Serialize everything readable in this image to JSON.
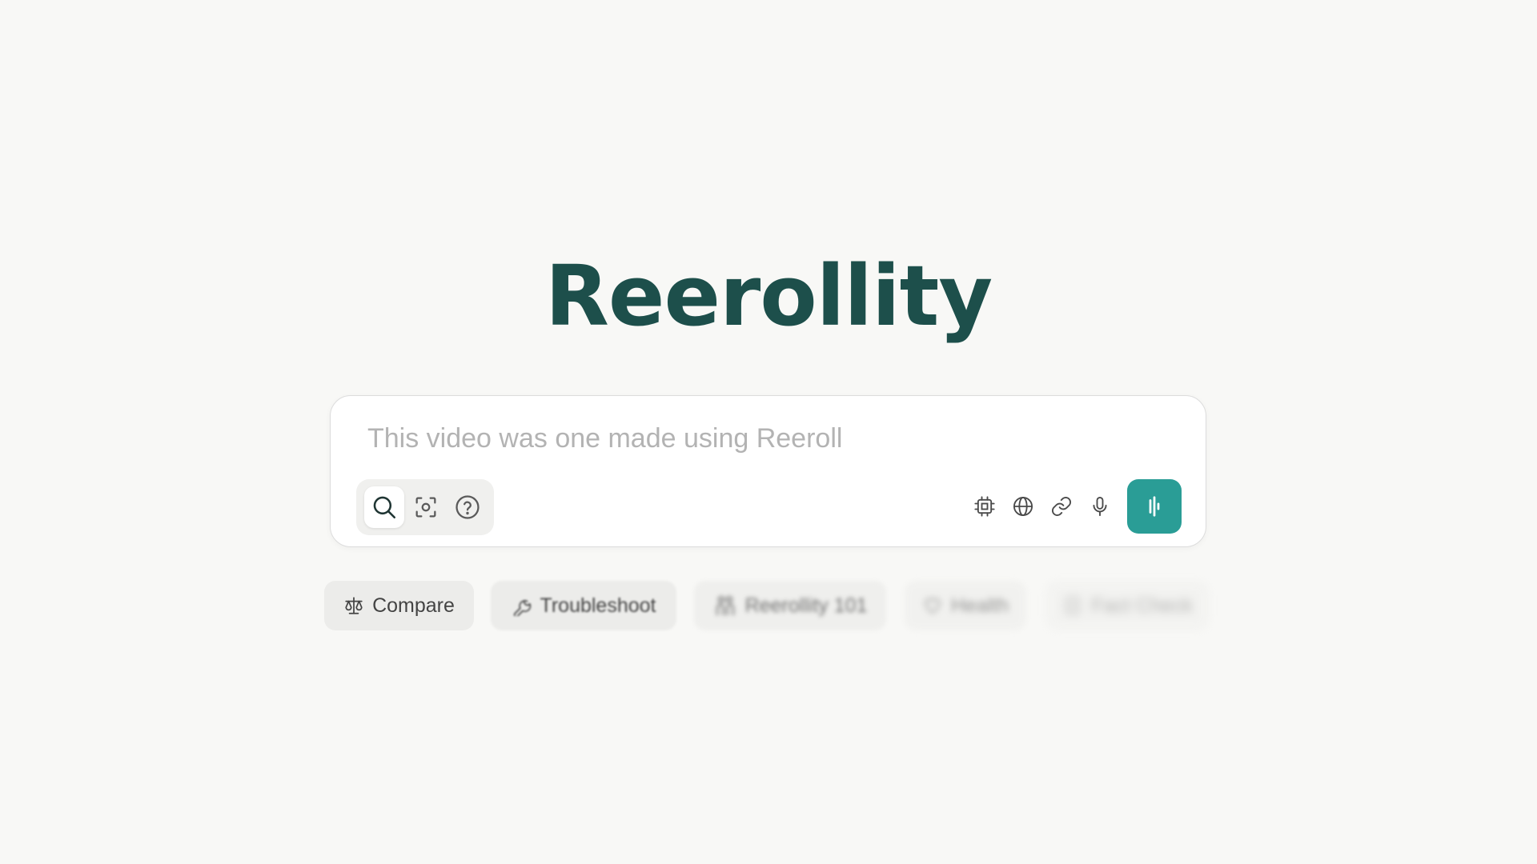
{
  "brand": {
    "logo_text": "Reerollity",
    "accent_color": "#2a9d96",
    "logo_color": "#1d4f4b"
  },
  "search": {
    "placeholder": "This video was one made using Reeroll",
    "value": ""
  },
  "modes": [
    {
      "icon": "search-icon",
      "active": true
    },
    {
      "icon": "focus-scan-icon",
      "active": false
    },
    {
      "icon": "help-circle-icon",
      "active": false
    }
  ],
  "tools": [
    {
      "icon": "chip-icon"
    },
    {
      "icon": "globe-icon"
    },
    {
      "icon": "link-icon"
    },
    {
      "icon": "microphone-icon"
    }
  ],
  "voice_button": {
    "icon": "audio-wave-icon"
  },
  "suggestions": [
    {
      "label": "Compare",
      "icon": "scale-icon"
    },
    {
      "label": "Troubleshoot",
      "icon": "wrench-icon"
    },
    {
      "label": "Reerollity 101",
      "icon": "people-icon"
    },
    {
      "label": "Health",
      "icon": "heart-icon"
    },
    {
      "label": "Fact Check",
      "icon": "check-icon"
    }
  ]
}
